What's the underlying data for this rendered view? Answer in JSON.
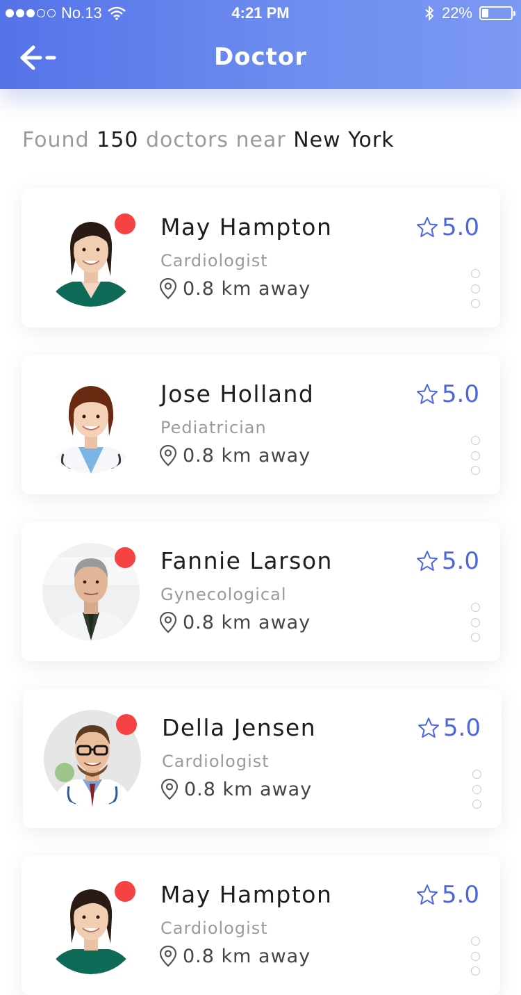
{
  "status_bar": {
    "carrier": "No.13",
    "time": "4:21 PM",
    "battery": "22%",
    "battery_level": 0.22,
    "signal_bars": 3,
    "signal_total": 5
  },
  "header": {
    "title": "Doctor",
    "back_icon": "back-arrow-icon",
    "gradient": [
      "#5573e8",
      "#7b98f2"
    ]
  },
  "summary": {
    "prefix": "Found",
    "count": "150",
    "middle": "doctors near",
    "city": "New York"
  },
  "accent_color": "#4b64e0",
  "online_color": "#f54242",
  "doctors": [
    {
      "name": "May Hampton",
      "specialty": "Cardiologist",
      "distance": "0.8 km away",
      "rating": "5.0",
      "online": true
    },
    {
      "name": "Jose Holland",
      "specialty": "Pediatrician",
      "distance": "0.8 km away",
      "rating": "5.0",
      "online": false
    },
    {
      "name": "Fannie Larson",
      "specialty": "Gynecological",
      "distance": "0.8 km away",
      "rating": "5.0",
      "online": true
    },
    {
      "name": "Della Jensen",
      "specialty": "Cardiologist",
      "distance": "0.8 km away",
      "rating": "5.0",
      "online": true
    },
    {
      "name": "May Hampton",
      "specialty": "Cardiologist",
      "distance": "0.8 km away",
      "rating": "5.0",
      "online": true
    }
  ]
}
